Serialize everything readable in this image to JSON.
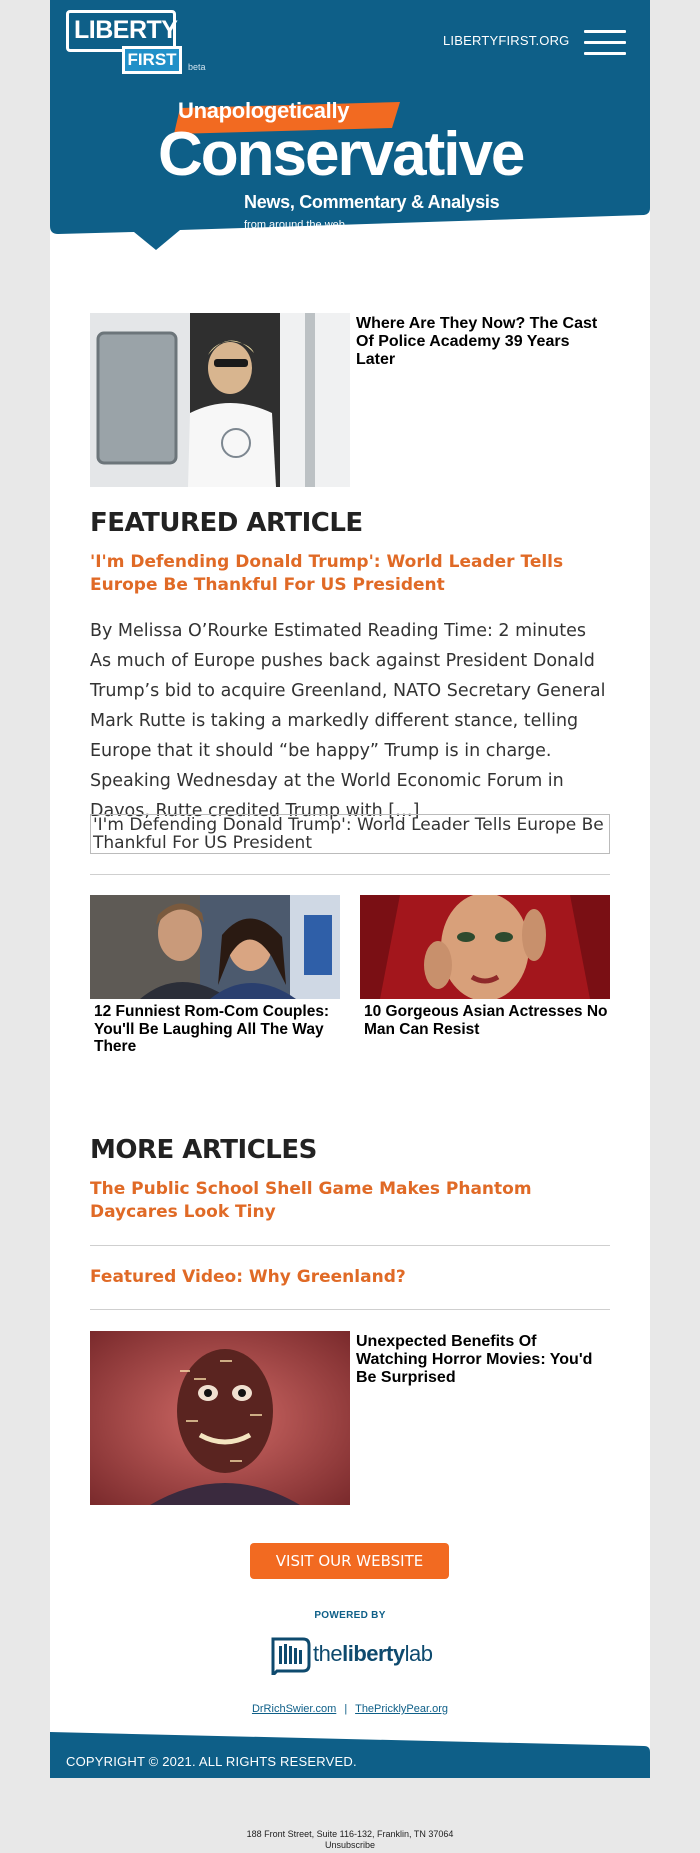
{
  "header": {
    "logo_top": "LIBERTY",
    "logo_bottom": "FIRST",
    "logo_beta": "beta",
    "site_link": "LIBERTYFIRST.ORG",
    "menu_icon": "hamburger-menu-icon"
  },
  "hero": {
    "tagline": "Unapologetically",
    "title": "Conservative",
    "subtitle": "News, Commentary & Analysis",
    "from": "from around the web"
  },
  "ads": {
    "top": {
      "title": "Where Are They Now? The Cast Of Police Academy 39 Years Later"
    },
    "tile_left": {
      "title": "12 Funniest Rom-Com Couples: You'll Be Laughing All The Way There"
    },
    "tile_right": {
      "title": "10 Gorgeous Asian Actresses No Man Can Resist"
    },
    "bottom": {
      "title": "Unexpected Benefits Of Watching Horror Movies: You'd Be Surprised"
    }
  },
  "featured": {
    "heading": "FEATURED ARTICLE",
    "title": "'I'm Defending Donald Trump': World Leader Tells Europe Be Thankful For US President",
    "excerpt": "By Melissa O’Rourke Estimated Reading Time: 2 minutes As much of Europe pushes back against President Donald Trump’s bid to acquire Greenland, NATO Secretary General Mark Rutte is taking a markedly different stance, telling Europe that it should “be happy” Trump is in charge. Speaking Wednesday at the World Economic Forum in Davos, Rutte credited Trump with […]",
    "image_alt": "'I'm Defending Donald Trump': World Leader Tells Europe Be Thankful For US President"
  },
  "more": {
    "heading": "MORE ARTICLES",
    "articles": [
      {
        "title": "The Public School Shell Game Makes Phantom Daycares Look Tiny"
      },
      {
        "title": "Featured Video: Why Greenland?"
      }
    ]
  },
  "footer": {
    "visit_button": "VISIT OUR WEBSITE",
    "powered_by": "POWERED BY",
    "lab_prefix": "the",
    "lab_bold": "liberty",
    "lab_suffix": "lab",
    "link1": "DrRichSwier.com",
    "separator": "|",
    "link2": "ThePricklyPear.org",
    "copyright": "COPYRIGHT © 2021. ALL RIGHTS RESERVED.",
    "address": "188 Front Street, Suite 116-132, Franklin, TN 37064",
    "unsubscribe": "Unsubscribe"
  },
  "colors": {
    "brand_blue": "#0e5f88",
    "accent_orange": "#e06a26",
    "button_orange": "#f26a21"
  }
}
